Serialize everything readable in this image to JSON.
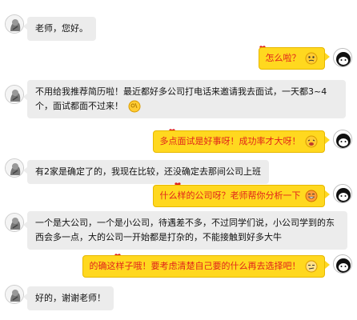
{
  "messages": [
    {
      "side": "left",
      "text": "老师，您好。"
    },
    {
      "side": "right",
      "text": "怎么啦？",
      "emoji": "confused-face-icon"
    },
    {
      "side": "left",
      "text": "不用给我推荐简历啦！最近都好多公司打电话来邀请我去面试，一天都3~4个，面试都面不过来！",
      "emoji": "ok-hand-icon"
    },
    {
      "side": "right",
      "text": "多点面试是好事呀！成功率才大呀！",
      "emoji": "cheering-face-icon"
    },
    {
      "side": "left",
      "text": "有2家是确定了的，我现在比较，还没确定去那间公司上班"
    },
    {
      "side": "right",
      "text": "什么样的公司呀？老师帮你分析一下",
      "emoji": "grinning-face-icon"
    },
    {
      "side": "left",
      "text": "一个是大公司，一个是小公司，待遇差不多，不过同学们说，小公司学到的东西会多一点，大的公司一开始都是打杂的，不能接触到好多大牛"
    },
    {
      "side": "right",
      "text": "的确这样子哦！要考虑清楚自己要的什么再去选择吧！",
      "emoji": "smirk-face-icon"
    },
    {
      "side": "left",
      "text": "好的，谢谢老师！"
    }
  ],
  "colors": {
    "left_bubble": "#ececec",
    "right_bubble": "#ffd81f",
    "right_text": "#e0221c",
    "left_text": "#111111"
  }
}
